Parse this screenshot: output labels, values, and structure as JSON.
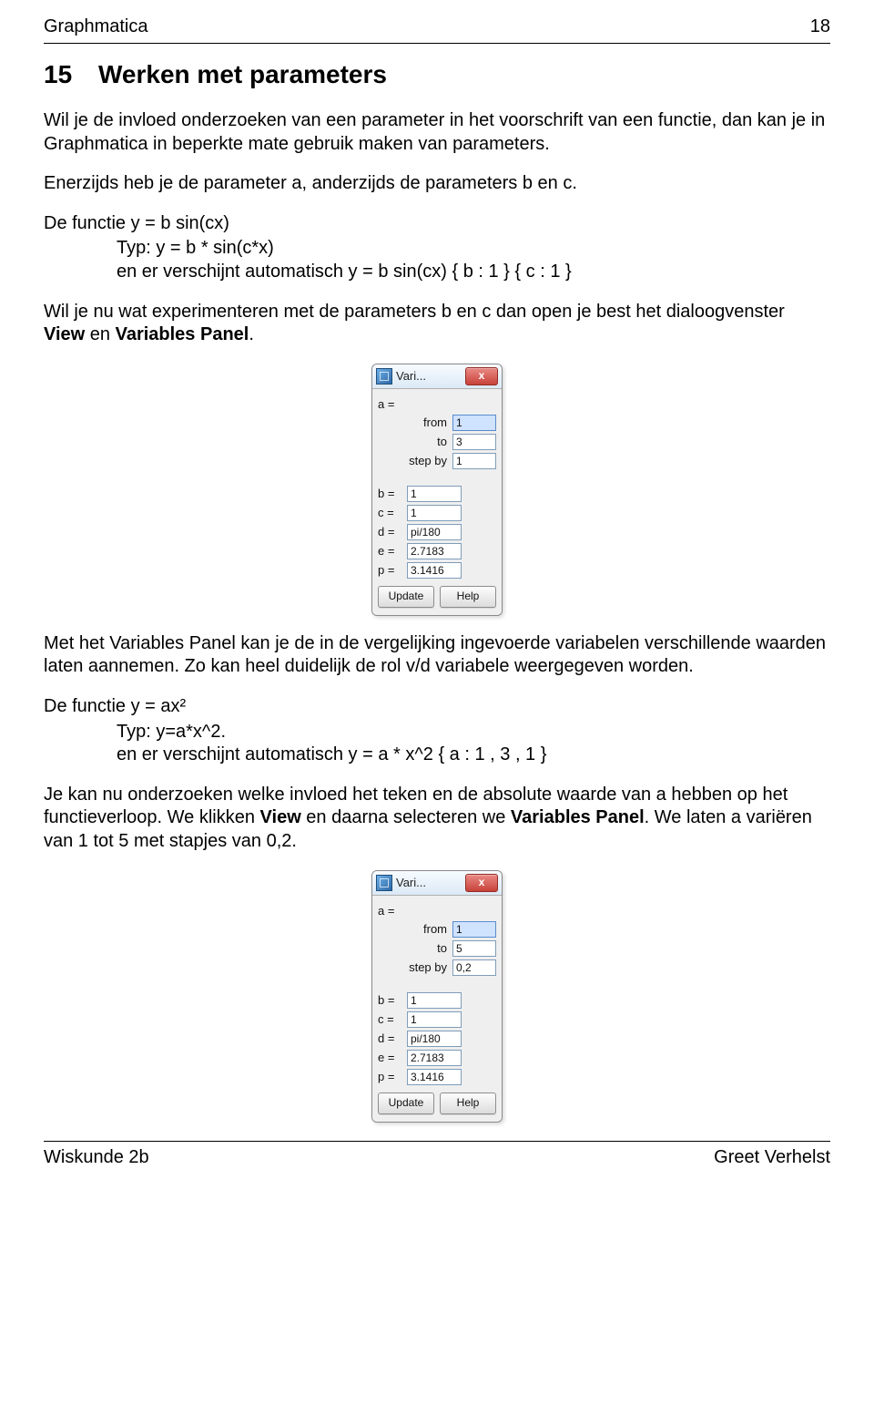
{
  "header": {
    "left": "Graphmatica",
    "right": "18"
  },
  "footer": {
    "left": "Wiskunde 2b",
    "right": "Greet Verhelst"
  },
  "section": {
    "number": "15",
    "title": "Werken met parameters"
  },
  "para1": "Wil je de invloed onderzoeken van een parameter in het voorschrift van een functie, dan kan je in Graphmatica in beperkte mate gebruik maken van parameters.",
  "para2": "Enerzijds heb je de parameter a, anderzijds de parameters b en c.",
  "func1_line": "De functie  y = b sin(cx)",
  "func1_typ": "Typ: y = b * sin(c*x)",
  "func1_auto": "en er verschijnt automatisch y = b sin(cx) { b : 1 } { c : 1 }",
  "para3_a": "Wil je nu wat experimenteren met de parameters b en c dan open je best het dialoogvenster ",
  "para3_b_bold": "View",
  "para3_c": " en ",
  "para3_d_bold": "Variables Panel",
  "para3_e": ".",
  "panel1": {
    "title": "Vari...",
    "close": "x",
    "a": {
      "label": "a =",
      "from_label": "from",
      "from": "1",
      "to_label": "to",
      "to": "3",
      "step_label": "step by",
      "step": "1"
    },
    "rows": [
      {
        "label": "b =",
        "value": "1"
      },
      {
        "label": "c =",
        "value": "1"
      },
      {
        "label": "d =",
        "value": "pi/180"
      },
      {
        "label": "e =",
        "value": "2.7183"
      },
      {
        "label": "p =",
        "value": "3.1416"
      }
    ],
    "update": "Update",
    "help": "Help"
  },
  "para4": "Met het Variables Panel kan je de in de vergelijking ingevoerde variabelen verschillende waarden laten aannemen. Zo kan heel duidelijk de rol v/d variabele weergegeven worden.",
  "func2_line": "De functie  y = ax²",
  "func2_typ": "Typ:   y=a*x^2.",
  "func2_auto": "en er verschijnt automatisch y = a * x^2  { a : 1 , 3 , 1 }",
  "para5_a": "Je kan nu onderzoeken welke invloed het teken en de absolute waarde van a hebben op het functieverloop. We klikken ",
  "para5_b_bold": "View",
  "para5_c": " en daarna selecteren we ",
  "para5_d_bold": "Variables Panel",
  "para5_e": ". We laten a variëren van 1 tot 5 met stapjes van 0,2.",
  "panel2": {
    "title": "Vari...",
    "close": "x",
    "a": {
      "label": "a =",
      "from_label": "from",
      "from": "1",
      "to_label": "to",
      "to": "5",
      "step_label": "step by",
      "step": "0,2"
    },
    "rows": [
      {
        "label": "b =",
        "value": "1"
      },
      {
        "label": "c =",
        "value": "1"
      },
      {
        "label": "d =",
        "value": "pi/180"
      },
      {
        "label": "e =",
        "value": "2.7183"
      },
      {
        "label": "p =",
        "value": "3.1416"
      }
    ],
    "update": "Update",
    "help": "Help"
  }
}
